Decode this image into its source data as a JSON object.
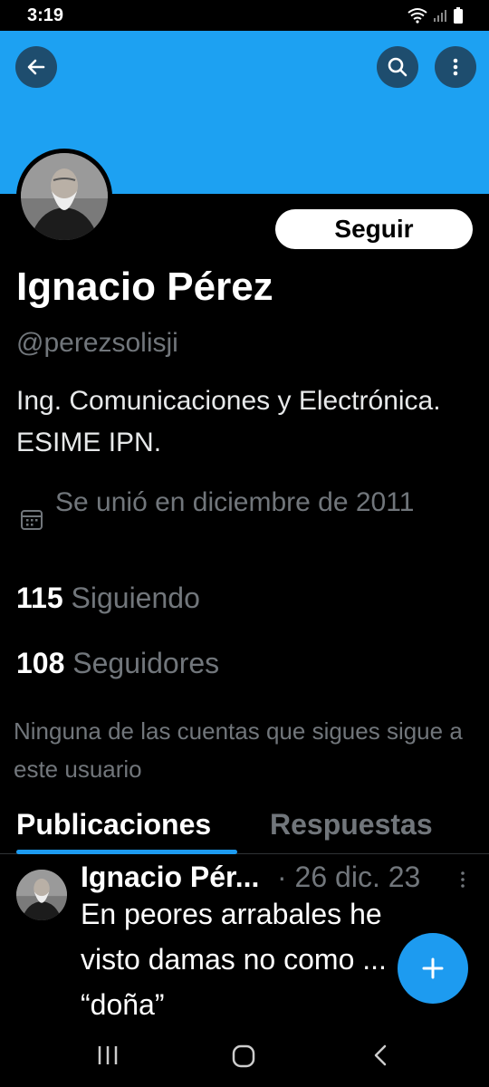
{
  "status_bar": {
    "time": "3:19"
  },
  "profile": {
    "name": "Ignacio Pérez",
    "handle": "@perezsolisji",
    "bio": "Ing. Comunicaciones y Electrónica. ESIME IPN.",
    "joined": "Se unió en diciembre de 2011",
    "following_count": "115",
    "following_label": "Siguiendo",
    "followers_count": "108",
    "followers_label": "Seguidores",
    "notice": "Ninguna de las cuentas que sigues sigue a este usuario"
  },
  "actions": {
    "follow_label": "Seguir"
  },
  "tabs": [
    {
      "label": "Publicaciones",
      "active": true
    },
    {
      "label": "Respuestas",
      "active": false
    }
  ],
  "post": {
    "author": "Ignacio Pér...",
    "meta": "· 26 dic. 23",
    "text": "En peores arrabales he visto damas no como ... “doña”"
  },
  "icons": {
    "back": "back-arrow-icon",
    "search": "search-icon",
    "more": "more-vertical-icon",
    "calendar": "calendar-icon",
    "compose": "plus-icon"
  },
  "colors": {
    "banner": "#1da1f2",
    "accent": "#1d9bf0",
    "background": "#000000",
    "muted": "#71767b"
  }
}
